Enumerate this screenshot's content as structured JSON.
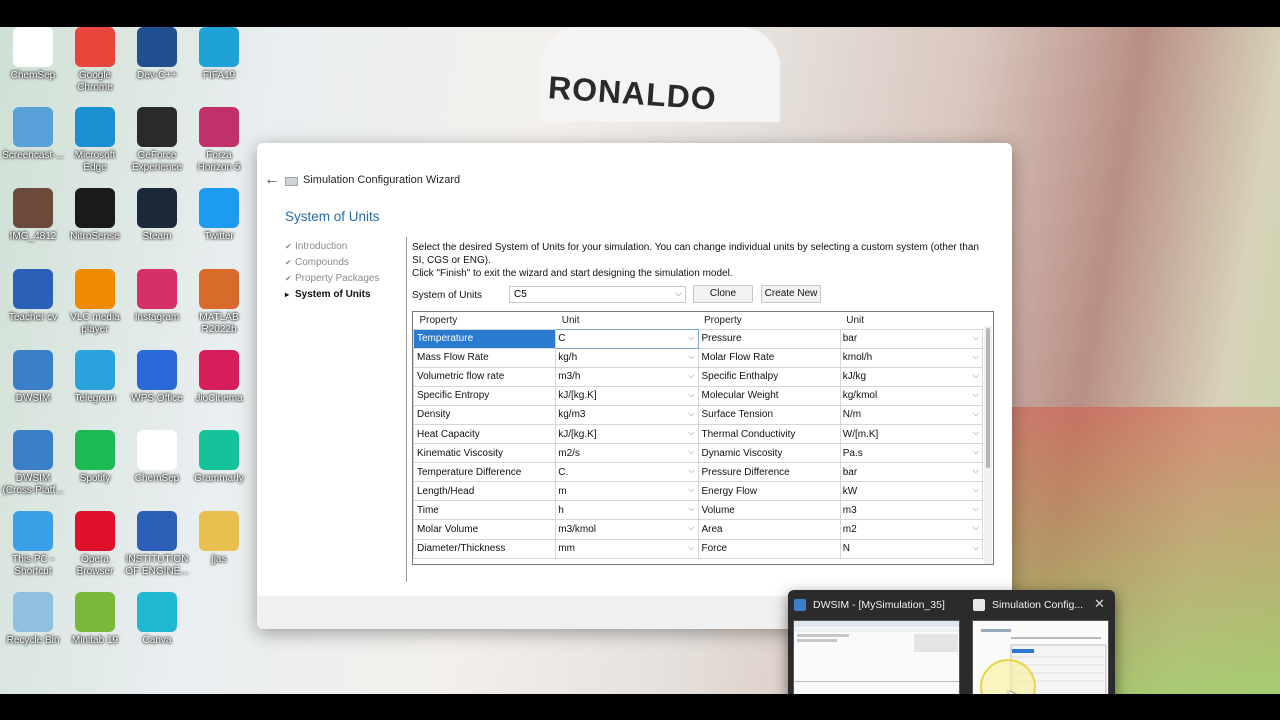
{
  "colors": {
    "accent": "#2a7ad0",
    "section_title": "#2a6aa8",
    "taskbar_preview": "#2b2b2b"
  },
  "wallpaper": {
    "jersey_text": "RONALDO"
  },
  "desktop_icons": [
    {
      "label": "ChemSep",
      "icon": "chemsep-icon",
      "color": "#ffffff"
    },
    {
      "label": "Google\nChrome",
      "icon": "chrome-icon",
      "color": "#e8453c"
    },
    {
      "label": "Dev-C++",
      "icon": "devcpp-icon",
      "color": "#1f4f8f"
    },
    {
      "label": "FIFA19",
      "icon": "fifa19-icon",
      "color": "#1fa3d6"
    },
    {
      "label": "Screencast-...",
      "icon": "screencast-icon",
      "color": "#5aa0d8"
    },
    {
      "label": "Microsoft\nEdge",
      "icon": "edge-icon",
      "color": "#1b8fd0"
    },
    {
      "label": "GeForce\nExperience",
      "icon": "geforce-icon",
      "color": "#2a2a2a"
    },
    {
      "label": "Forza\nHorizon 5",
      "icon": "forza-icon",
      "color": "#c0306a"
    },
    {
      "label": "IMG_4812",
      "icon": "image-icon",
      "color": "#6b4a3a"
    },
    {
      "label": "NitroSense",
      "icon": "nitrosense-icon",
      "color": "#1a1a1a"
    },
    {
      "label": "Steam",
      "icon": "steam-icon",
      "color": "#1b2838"
    },
    {
      "label": "Twitter",
      "icon": "twitter-icon",
      "color": "#1d9bf0"
    },
    {
      "label": "Teacher cv",
      "icon": "word-doc-icon",
      "color": "#2b5fb8"
    },
    {
      "label": "VLC media\nplayer",
      "icon": "vlc-icon",
      "color": "#f08a00"
    },
    {
      "label": "Instagram",
      "icon": "instagram-icon",
      "color": "#d6306a"
    },
    {
      "label": "MATLAB\nR2022b",
      "icon": "matlab-icon",
      "color": "#d86a2a"
    },
    {
      "label": "DWSIM",
      "icon": "dwsim-icon",
      "color": "#3a80c8"
    },
    {
      "label": "Telegram",
      "icon": "telegram-icon",
      "color": "#2aa3dd"
    },
    {
      "label": "WPS Office",
      "icon": "wps-icon",
      "color": "#2a6ad8"
    },
    {
      "label": "JioCinema",
      "icon": "jiocinema-icon",
      "color": "#d61f5a"
    },
    {
      "label": "DWSIM\n(Cross-Platf...",
      "icon": "dwsim-cross-icon",
      "color": "#3a80c8"
    },
    {
      "label": "Spotify",
      "icon": "spotify-icon",
      "color": "#1db954"
    },
    {
      "label": "ChemSep",
      "icon": "chemsep-icon",
      "color": "#ffffff"
    },
    {
      "label": "Grammarly",
      "icon": "grammarly-icon",
      "color": "#15c39a"
    },
    {
      "label": "This PC -\nShortcut",
      "icon": "this-pc-icon",
      "color": "#3aa0e8"
    },
    {
      "label": "Opera\nBrowser",
      "icon": "opera-icon",
      "color": "#e0102a"
    },
    {
      "label": "INSTITUTION\nOF ENGINE...",
      "icon": "word-doc-icon",
      "color": "#2b5fb8"
    },
    {
      "label": "jjas",
      "icon": "folder-icon",
      "color": "#e8c050"
    },
    {
      "label": "Recycle Bin",
      "icon": "recycle-bin-icon",
      "color": "#8fc0e0"
    },
    {
      "label": "Minitab 19",
      "icon": "minitab-icon",
      "color": "#78b83a"
    },
    {
      "label": "Canva",
      "icon": "canva-icon",
      "color": "#20b8d0"
    }
  ],
  "dialog": {
    "title": "Simulation Configuration Wizard",
    "section_title": "System of Units",
    "steps": [
      {
        "label": "Introduction",
        "current": false
      },
      {
        "label": "Compounds",
        "current": false
      },
      {
        "label": "Property Packages",
        "current": false
      },
      {
        "label": "System of Units",
        "current": true
      }
    ],
    "description": "Select the desired System of Units for your simulation. You can change individual units by selecting a custom system (other than SI, CGS or ENG).",
    "description2": "Click \"Finish\" to exit the wizard and start designing the simulation model.",
    "system_label": "System of Units",
    "system_value": "C5",
    "clone_label": "Clone",
    "create_new_label": "Create New",
    "table_headers": [
      "Property",
      "Unit",
      "Property",
      "Unit"
    ],
    "rows": [
      [
        "Temperature",
        "C",
        "Pressure",
        "bar"
      ],
      [
        "Mass Flow Rate",
        "kg/h",
        "Molar Flow Rate",
        "kmol/h"
      ],
      [
        "Volumetric flow rate",
        "m3/h",
        "Specific Enthalpy",
        "kJ/kg"
      ],
      [
        "Specific Entropy",
        "kJ/[kg.K]",
        "Molecular Weight",
        "kg/kmol"
      ],
      [
        "Density",
        "kg/m3",
        "Surface Tension",
        "N/m"
      ],
      [
        "Heat Capacity",
        "kJ/[kg.K]",
        "Thermal Conductivity",
        "W/[m.K]"
      ],
      [
        "Kinematic Viscosity",
        "m2/s",
        "Dynamic Viscosity",
        "Pa.s"
      ],
      [
        "Temperature Difference",
        "C.",
        "Pressure Difference",
        "bar"
      ],
      [
        "Length/Head",
        "m",
        "Energy Flow",
        "kW"
      ],
      [
        "Time",
        "h",
        "Volume",
        "m3"
      ],
      [
        "Molar Volume",
        "m3/kmol",
        "Area",
        "m2"
      ],
      [
        "Diameter/Thickness",
        "mm",
        "Force",
        "N"
      ]
    ]
  },
  "task_preview": {
    "item1": "DWSIM - [MySimulation_35]",
    "item2": "Simulation Config...",
    "close": "✕"
  }
}
